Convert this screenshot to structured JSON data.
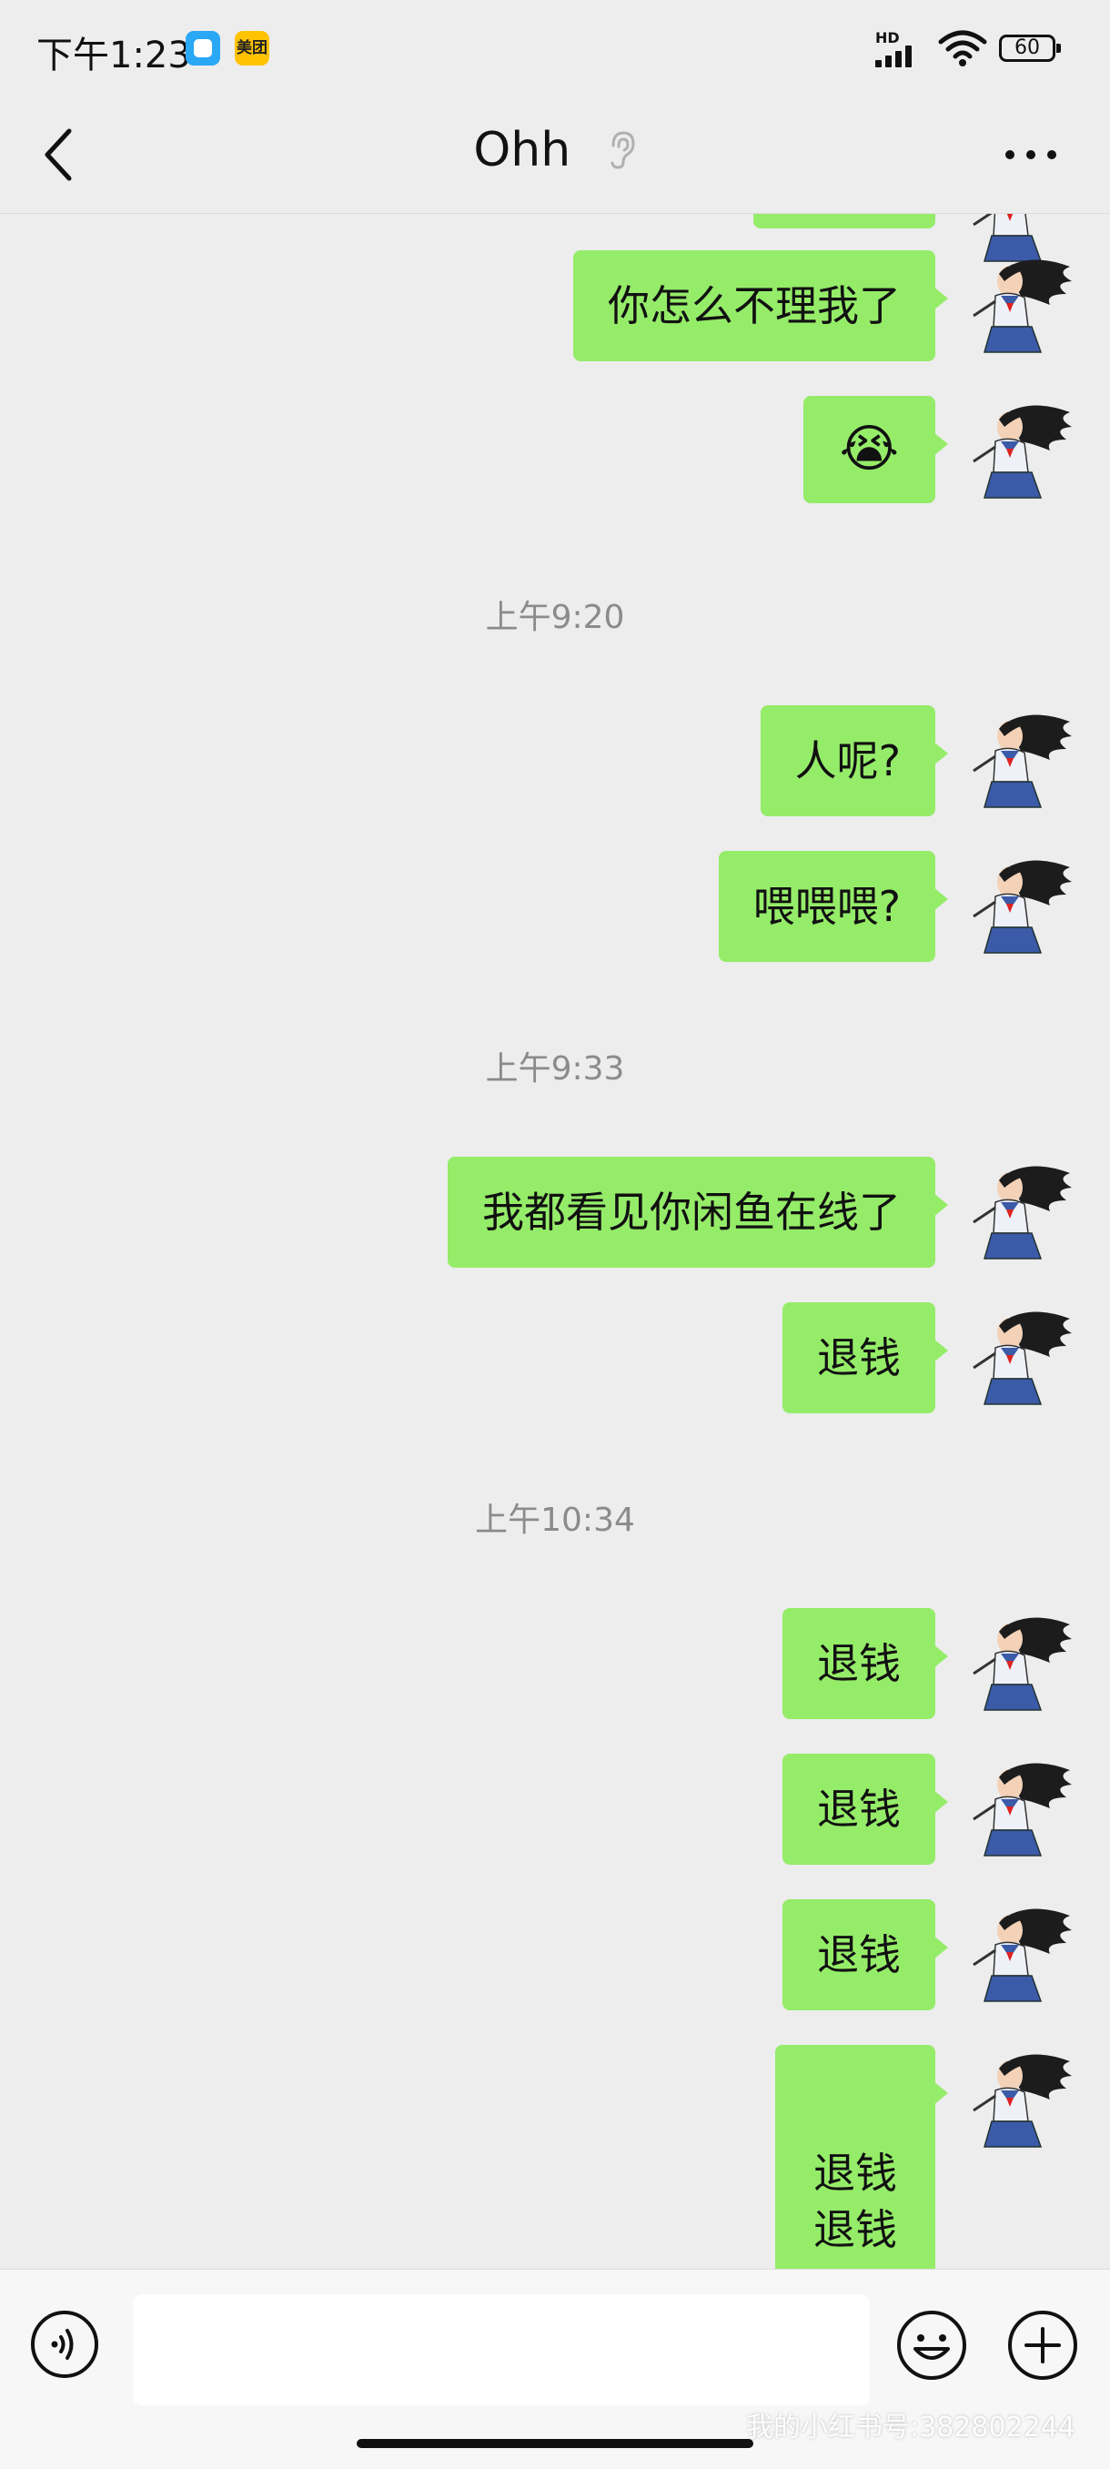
{
  "status_bar": {
    "time": "下午1:23",
    "app_badge_2": "美团",
    "network": "HD",
    "battery": "60"
  },
  "header": {
    "title": "Ohh"
  },
  "messages": [
    {
      "type": "text",
      "text": "你怎么不理我了"
    },
    {
      "type": "emoji",
      "icon": "loudly-crying-face",
      "text": "😭"
    },
    {
      "type": "time",
      "text": "上午9:20"
    },
    {
      "type": "text",
      "text": "人呢?"
    },
    {
      "type": "text",
      "text": "喂喂喂?"
    },
    {
      "type": "time",
      "text": "上午9:33"
    },
    {
      "type": "text",
      "text": "我都看见你闲鱼在线了"
    },
    {
      "type": "text",
      "text": "退钱"
    },
    {
      "type": "time",
      "text": "上午10:34"
    },
    {
      "type": "text",
      "text": "退钱"
    },
    {
      "type": "text",
      "text": "退钱"
    },
    {
      "type": "text",
      "text": "退钱"
    },
    {
      "type": "text",
      "lines": [
        "退钱",
        "退钱"
      ]
    }
  ],
  "input": {
    "placeholder": ""
  },
  "watermark": "我的小红书号:382802244",
  "colors": {
    "bubble_self": "#95ec69",
    "background": "#ededed",
    "timestamp": "#8b8b8b"
  }
}
